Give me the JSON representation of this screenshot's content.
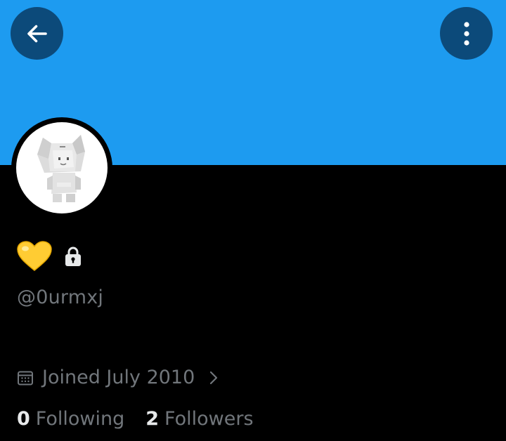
{
  "colors": {
    "banner": "#1d9bf0",
    "button_bg": "#0c4a7a",
    "page_bg": "#000000",
    "primary_text": "#e7e9ea",
    "secondary_text": "#71767b",
    "heart": "#ffcc33"
  },
  "header": {
    "back_icon": "arrow-left-icon",
    "more_icon": "more-vertical-icon"
  },
  "profile": {
    "avatar": "white-cat-figure-avatar",
    "display_name_icons": [
      "yellow-heart-icon",
      "lock-icon"
    ],
    "handle": "@0urmxj",
    "joined_icon": "calendar-icon",
    "joined": "Joined July 2010"
  },
  "stats": {
    "following_count": "0",
    "following_label": "Following",
    "followers_count": "2",
    "followers_label": "Followers"
  }
}
